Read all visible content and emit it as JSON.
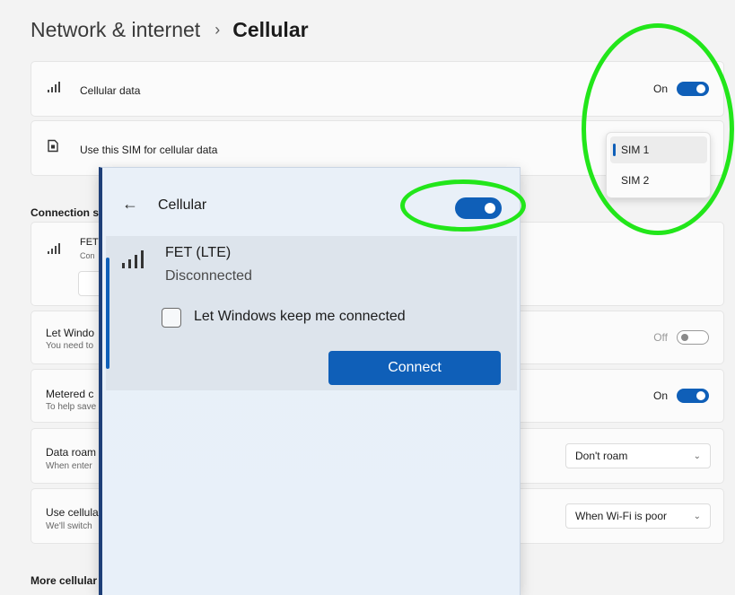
{
  "header": {
    "parent": "Network & internet",
    "separator": "›",
    "current": "Cellular"
  },
  "cellular_data": {
    "label": "Cellular data",
    "state": "On",
    "icon": "signal-icon"
  },
  "sim_choice": {
    "label": "Use this SIM for cellular data",
    "icon": "sim-card-icon",
    "options": [
      "SIM 1",
      "SIM 2"
    ],
    "selected": "SIM 1"
  },
  "sections": {
    "connection_settings": "Connection s",
    "more_cellular": "More cellular"
  },
  "connection_card": {
    "title": "FET",
    "sub": "Con"
  },
  "keep_connected_row": {
    "title": "Let Windo",
    "sub": "You need to",
    "state": "Off"
  },
  "metered_row": {
    "title": "Metered c",
    "sub": "To help save",
    "state": "On"
  },
  "roaming_row": {
    "title": "Data roam",
    "sub": "When enter",
    "value": "Don't roam"
  },
  "use_cellular_row": {
    "title": "Use cellula",
    "sub": "We'll switch",
    "value": "When Wi-Fi is poor"
  },
  "flyout": {
    "title": "Cellular",
    "toggle_state": "on",
    "network": {
      "name": "FET (LTE)",
      "status": "Disconnected",
      "checkbox_label": "Let Windows keep me connected",
      "checkbox_checked": false,
      "connect_label": "Connect"
    }
  },
  "colors": {
    "accent": "#0f5fb8",
    "highlight": "#22e61a",
    "flyout_edge": "#1e3f78"
  }
}
